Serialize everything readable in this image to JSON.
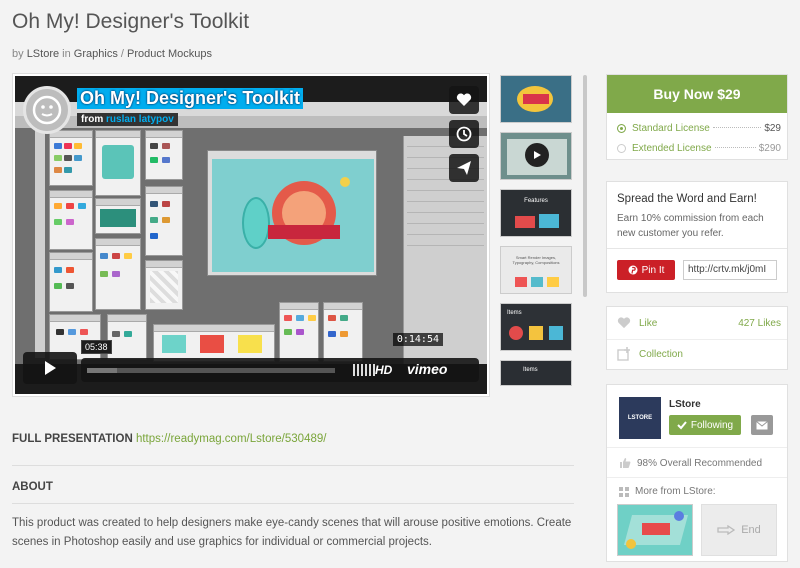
{
  "page": {
    "title": "Oh My! Designer's Toolkit",
    "breadcrumb": {
      "by": "by",
      "author": "LStore",
      "in": "in",
      "category": "Graphics",
      "sep": "/",
      "subcategory": "Product Mockups"
    }
  },
  "video": {
    "title": "Oh My! Designer's Toolkit",
    "from_label": "from",
    "author": "ruslan latypov",
    "current_time": "05:38",
    "timecode": "0:14:54",
    "hd_label": "HD",
    "brand": "vimeo",
    "progress": 0.12,
    "side_buttons": [
      "heart-icon",
      "clock-icon",
      "send-icon"
    ]
  },
  "thumbnails": [
    {
      "label": "",
      "bg": "#3a6f86"
    },
    {
      "label": "",
      "bg": "#6e8f8c",
      "has_play": true
    },
    {
      "label": "Features",
      "bg": "#2b2f33"
    },
    {
      "label": "Smart Render Images, Typography, Compositions",
      "bg": "#eaeaea"
    },
    {
      "label": "Items",
      "bg": "#2d3136"
    },
    {
      "label": "Items",
      "bg": "#2a2e33"
    }
  ],
  "details": {
    "full_presentation_label": "FULL PRESENTATION",
    "full_presentation_url": "https://readymag.com/Lstore/530489/",
    "about_heading": "ABOUT",
    "about_text": "This product was created to help designers make eye-candy scenes that will arouse positive emotions. Create scenes in Photoshop easily and use graphics for individual or commercial projects."
  },
  "purchase": {
    "buy_label": "Buy Now $29",
    "licenses": [
      {
        "name": "Standard License",
        "price": "$29",
        "selected": true
      },
      {
        "name": "Extended License",
        "price": "$290",
        "selected": false
      }
    ]
  },
  "earn": {
    "heading": "Spread the Word and Earn!",
    "text": "Earn 10% commission from each new customer you refer.",
    "pin_label": "Pin It",
    "ref_url": "http://crtv.mk/j0mI"
  },
  "social": {
    "like_label": "Like",
    "like_count": "427 Likes",
    "collection_label": "Collection"
  },
  "seller": {
    "logo_text": "LSTORE",
    "name": "LStore",
    "follow_label": "Following",
    "recommended": "98% Overall Recommended",
    "more_label": "More from LStore:",
    "end_label": "End"
  },
  "colors": {
    "accent": "#80a94a",
    "vimeo_blue": "#00adef",
    "pinterest": "#cb2027"
  }
}
